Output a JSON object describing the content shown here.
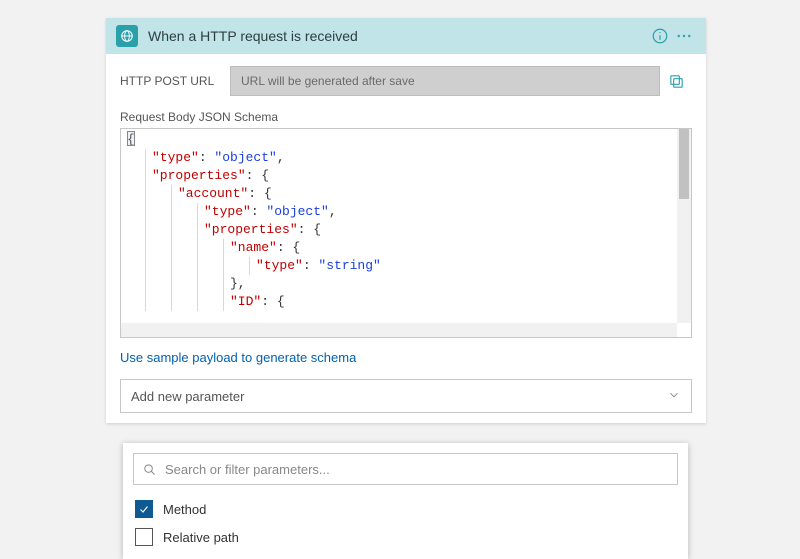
{
  "header": {
    "title": "When a HTTP request is received"
  },
  "urlRow": {
    "label": "HTTP POST URL",
    "value": "URL will be generated after save"
  },
  "schema": {
    "label": "Request Body JSON Schema",
    "lines": [
      [
        [
          "pun",
          "{"
        ]
      ],
      [
        [
          "ind",
          1
        ],
        [
          "key",
          "\"type\""
        ],
        [
          "pun",
          ": "
        ],
        [
          "str",
          "\"object\""
        ],
        [
          "pun",
          ","
        ]
      ],
      [
        [
          "ind",
          1
        ],
        [
          "key",
          "\"properties\""
        ],
        [
          "pun",
          ": {"
        ]
      ],
      [
        [
          "ind",
          2
        ],
        [
          "key",
          "\"account\""
        ],
        [
          "pun",
          ": {"
        ]
      ],
      [
        [
          "ind",
          3
        ],
        [
          "key",
          "\"type\""
        ],
        [
          "pun",
          ": "
        ],
        [
          "str",
          "\"object\""
        ],
        [
          "pun",
          ","
        ]
      ],
      [
        [
          "ind",
          3
        ],
        [
          "key",
          "\"properties\""
        ],
        [
          "pun",
          ": {"
        ]
      ],
      [
        [
          "ind",
          4
        ],
        [
          "key",
          "\"name\""
        ],
        [
          "pun",
          ": {"
        ]
      ],
      [
        [
          "ind",
          5
        ],
        [
          "key",
          "\"type\""
        ],
        [
          "pun",
          ": "
        ],
        [
          "str",
          "\"string\""
        ]
      ],
      [
        [
          "ind",
          4
        ],
        [
          "pun",
          "},"
        ]
      ],
      [
        [
          "ind",
          4
        ],
        [
          "key",
          "\"ID\""
        ],
        [
          "pun",
          ": {"
        ]
      ]
    ]
  },
  "samplePayloadLink": "Use sample payload to generate schema",
  "addParam": {
    "label": "Add new parameter"
  },
  "dropdown": {
    "searchPlaceholder": "Search or filter parameters...",
    "options": [
      {
        "label": "Method",
        "checked": true
      },
      {
        "label": "Relative path",
        "checked": false
      }
    ]
  }
}
